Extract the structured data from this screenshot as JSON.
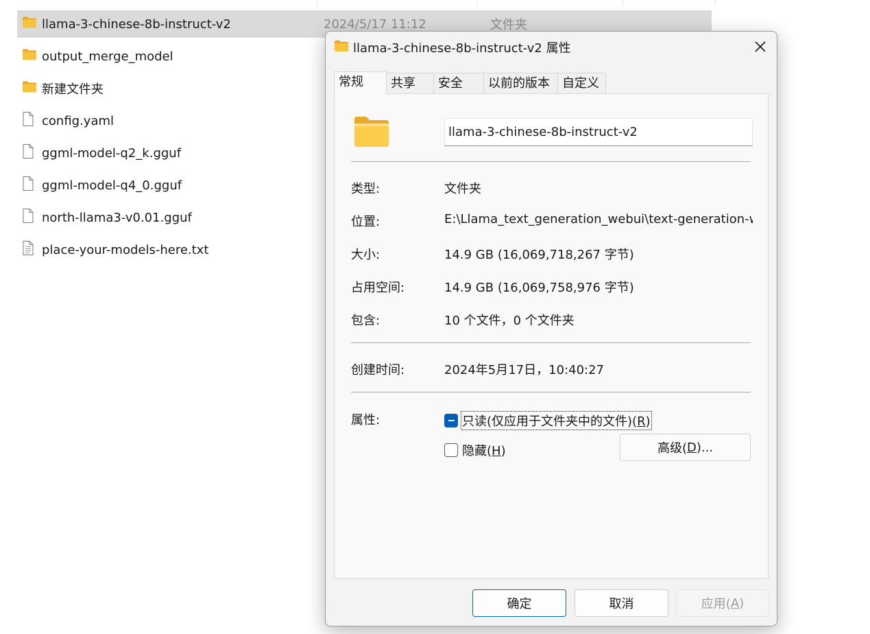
{
  "explorer": {
    "files": [
      {
        "name": "llama-3-chinese-8b-instruct-v2",
        "date": "2024/5/17 11:12",
        "type": "文件夹",
        "icon": "folder-icon",
        "selected": true
      },
      {
        "name": "output_merge_model",
        "icon": "folder-icon"
      },
      {
        "name": "新建文件夹",
        "icon": "folder-icon"
      },
      {
        "name": "config.yaml",
        "icon": "file-icon"
      },
      {
        "name": "ggml-model-q2_k.gguf",
        "icon": "file-icon"
      },
      {
        "name": "ggml-model-q4_0.gguf",
        "icon": "file-icon"
      },
      {
        "name": "north-llama3-v0.01.gguf",
        "icon": "file-icon"
      },
      {
        "name": "place-your-models-here.txt",
        "icon": "text-file-icon"
      }
    ]
  },
  "dialog": {
    "title": "llama-3-chinese-8b-instruct-v2 属性",
    "tabs": [
      "常规",
      "共享",
      "安全",
      "以前的版本",
      "自定义"
    ],
    "active_tab": "常规",
    "folder_name": "llama-3-chinese-8b-instruct-v2",
    "properties": [
      {
        "label": "类型:",
        "value": "文件夹"
      },
      {
        "label": "位置:",
        "value": "E:\\Llama_text_generation_webui\\text-generation-we"
      },
      {
        "label": "大小:",
        "value": "14.9 GB (16,069,718,267 字节)"
      },
      {
        "label": "占用空间:",
        "value": "14.9 GB (16,069,758,976 字节)"
      },
      {
        "label": "包含:",
        "value": "10 个文件，0 个文件夹"
      }
    ],
    "created": {
      "label": "创建时间:",
      "value": "2024年5月17日，10:40:27"
    },
    "attributes": {
      "label": "属性:",
      "readonly": {
        "text": "只读(仅应用于文件夹中的文件)(",
        "key": "R",
        "suffix": ")",
        "state": "indeterminate"
      },
      "hidden": {
        "text": "隐藏(",
        "key": "H",
        "suffix": ")",
        "state": "unchecked"
      },
      "advanced": {
        "text": "高级(",
        "key": "D",
        "suffix": ")..."
      }
    },
    "buttons": {
      "ok": "确定",
      "cancel": "取消",
      "apply": {
        "text": "应用(",
        "key": "A",
        "suffix": ")"
      }
    }
  },
  "colors": {
    "accent": "#005fb8",
    "selected_row": "#dadada",
    "folder": "#f8c33c",
    "disabled_text": "#9c9c9c"
  }
}
